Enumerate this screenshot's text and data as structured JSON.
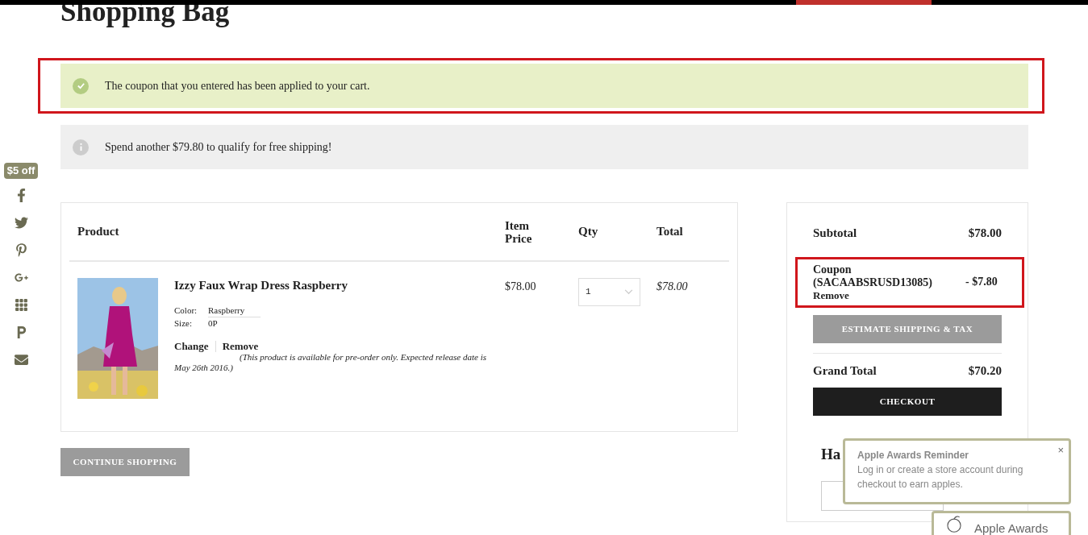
{
  "title": "Shopping Bag",
  "alerts": [
    {
      "kind": "success",
      "text": "The coupon that you entered has been applied to your cart.",
      "highlighted": true
    },
    {
      "kind": "info",
      "text": "Spend another $79.80 to qualify for free shipping!",
      "highlighted": false
    }
  ],
  "share_bar": {
    "badge": "$5 off"
  },
  "cart": {
    "columns": [
      "Product",
      "Item Price",
      "Qty",
      "Total"
    ],
    "items": [
      {
        "name": "Izzy Faux Wrap Dress Raspberry",
        "options": [
          {
            "label": "Color:",
            "value": "Raspberry"
          },
          {
            "label": "Size:",
            "value": "0P"
          }
        ],
        "actions": [
          "Change",
          "Remove"
        ],
        "note": "(This product is available for pre-order only. Expected release date is May 26th 2016.)",
        "price": "$78.00",
        "qty": "1",
        "total": "$78.00"
      }
    ]
  },
  "continue_button": "CONTINUE SHOPPING",
  "summary": {
    "subtotal": {
      "label": "Subtotal",
      "value": "$78.00"
    },
    "coupon": {
      "label": "Coupon (SACAABSRUSD13085)",
      "remove": "Remove",
      "value": "- $7.80",
      "highlighted": true
    },
    "estimate_button": "ESTIMATE SHIPPING & TAX",
    "grand_total": {
      "label": "Grand Total",
      "value": "$70.20"
    },
    "checkout_button": "CHECKOUT"
  },
  "promo": {
    "heading": "Ha"
  },
  "reminder": {
    "title": "Apple Awards Reminder",
    "text": "Log in or create a store account during checkout to earn apples.",
    "close": "×"
  },
  "reminder_tab": {
    "label": "Apple Awards"
  }
}
